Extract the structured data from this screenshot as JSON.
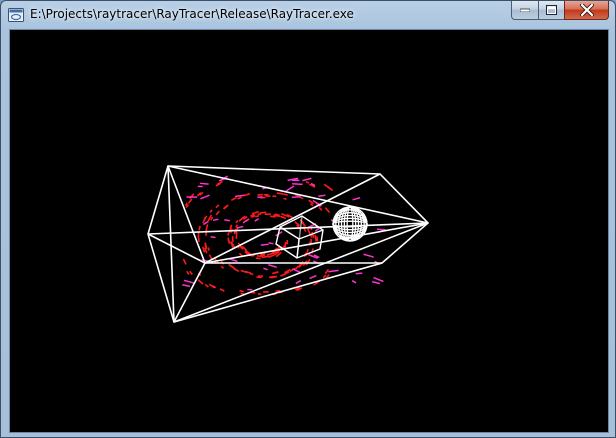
{
  "window": {
    "title": "E:\\Projects\\raytracer\\RayTracer\\Release\\RayTracer.exe",
    "app_icon": "console-app-icon",
    "controls": [
      "minimize-icon",
      "maximize-icon",
      "close-icon"
    ]
  },
  "viewport": {
    "background": "#000000",
    "wire_color": "#ffffff",
    "sample_colors": [
      "#ff1a1a",
      "#ff33cc"
    ]
  }
}
